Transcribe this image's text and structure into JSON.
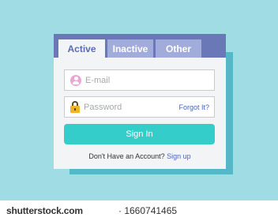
{
  "tabs": {
    "active_label": "Active",
    "inactive_label": "Inactive",
    "other_label": "Other"
  },
  "email": {
    "placeholder": "E-mail",
    "value": ""
  },
  "password": {
    "placeholder": "Password",
    "value": "",
    "forgot_label": "Forgot It?"
  },
  "signin": {
    "label": "Sign In"
  },
  "signup": {
    "prompt": "Don't Have an Account?",
    "link": "Sign up"
  },
  "icons": {
    "email_icon": "user-icon",
    "password_icon": "lock-icon"
  },
  "colors": {
    "background": "#9fdce4",
    "tab_bar": "#6b78b8",
    "tab_inactive": "#a2acdb",
    "button": "#35cdc9",
    "link": "#4a66b8"
  },
  "watermark": {
    "domain": "shutterstock.com",
    "id": "· 1660741465"
  }
}
